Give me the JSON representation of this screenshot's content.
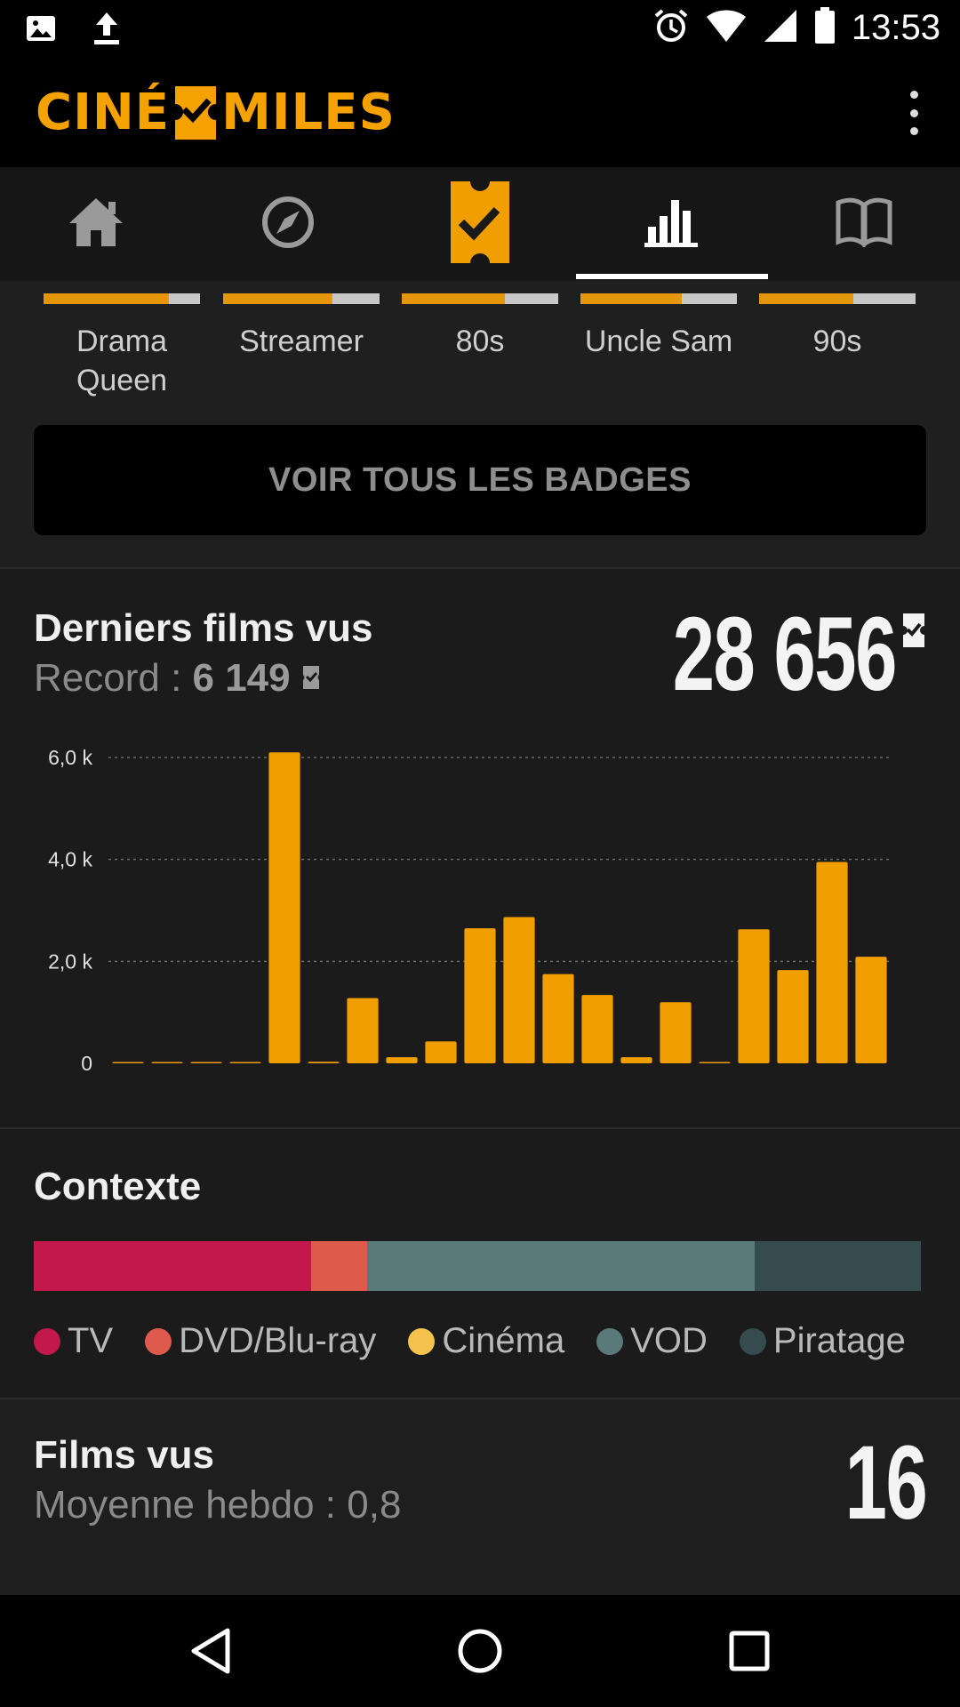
{
  "status_bar": {
    "time": "13:53",
    "icons": [
      "image-icon",
      "upload-icon",
      "alarm-icon",
      "wifi-icon",
      "signal-icon",
      "battery-icon"
    ]
  },
  "app_bar": {
    "logo_left": "CINÉ",
    "logo_right": "MILES",
    "brand_color": "#f5a200",
    "menu_icon": "overflow-menu-icon"
  },
  "tabs": [
    {
      "name": "home",
      "icon": "home-icon",
      "active": false
    },
    {
      "name": "explore",
      "icon": "compass-icon",
      "active": false
    },
    {
      "name": "ticket",
      "icon": "ticket-check-icon",
      "active": false
    },
    {
      "name": "stats",
      "icon": "bar-chart-icon",
      "active": true
    },
    {
      "name": "journal",
      "icon": "book-icon",
      "active": false
    }
  ],
  "badges": {
    "items": [
      {
        "label": "Drama Queen",
        "progress": 0.8
      },
      {
        "label": "Streamer",
        "progress": 0.7
      },
      {
        "label": "80s",
        "progress": 0.66
      },
      {
        "label": "Uncle Sam",
        "progress": 0.65
      },
      {
        "label": "90s",
        "progress": 0.6
      }
    ],
    "see_all_label": "VOIR TOUS LES BADGES"
  },
  "derniers_films": {
    "title": "Derniers films vus",
    "record_label": "Record : ",
    "record_value": "6 149",
    "total": "28 656"
  },
  "chart_data": {
    "type": "bar",
    "title": "",
    "xlabel": "",
    "ylabel": "",
    "ylim": [
      0,
      6000
    ],
    "yticks": [
      "0",
      "2,0 k",
      "4,0 k",
      "6,0 k"
    ],
    "grid": true,
    "bar_color": "#f09e00",
    "values": [
      0,
      0,
      0,
      0,
      6100,
      30,
      1280,
      120,
      430,
      2650,
      2870,
      1750,
      1340,
      120,
      1200,
      0,
      2630,
      1830,
      3950,
      2090
    ]
  },
  "contexte": {
    "title": "Contexte",
    "segments": [
      {
        "label": "TV",
        "color": "#c2184b",
        "fraction": 0.313
      },
      {
        "label": "DVD/Blu-ray",
        "color": "#dd5a4c",
        "fraction": 0.063
      },
      {
        "label": "Cinéma",
        "color": "#f5c24e",
        "fraction": 0.0
      },
      {
        "label": "VOD",
        "color": "#5a7a7a",
        "fraction": 0.437
      },
      {
        "label": "Piratage",
        "color": "#354b4d",
        "fraction": 0.187
      }
    ]
  },
  "films_vus": {
    "title": "Films vus",
    "subtitle": "Moyenne hebdo : 0,8",
    "count": "16"
  },
  "nav": {
    "back_icon": "back-icon",
    "home_icon": "home-circle-icon",
    "recents_icon": "recents-icon"
  }
}
